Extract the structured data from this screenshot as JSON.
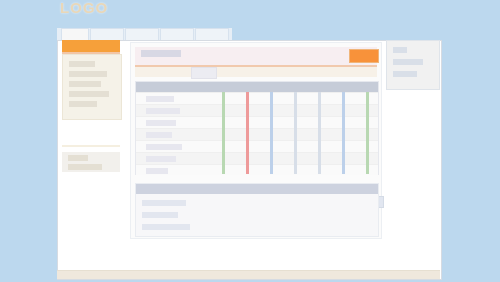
{
  "logo": {
    "text": "LOGO"
  }
}
